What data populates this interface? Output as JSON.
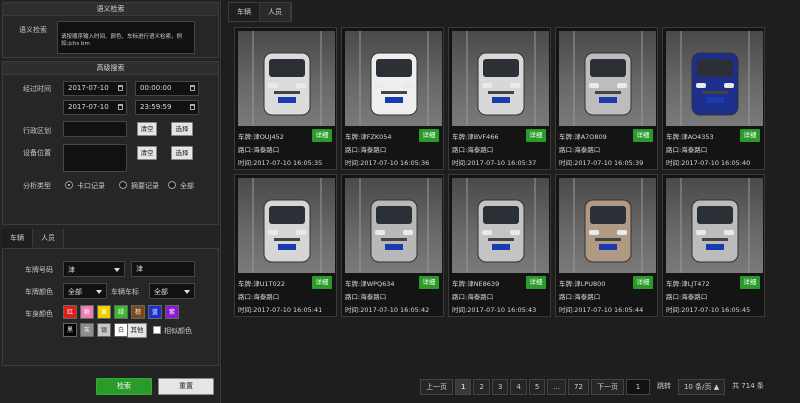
{
  "semantic": {
    "title": "语义检索",
    "label": "语义检索",
    "placeholder": "请按顺序输入时间、颜色、车标进行语义检索，例如:jchs bm"
  },
  "advanced": {
    "title": "高级搜索",
    "pass_time_label": "经过时间",
    "start_date": "2017-07-10",
    "start_time": "00:00:00",
    "end_date": "2017-07-10",
    "end_time": "23:59:59",
    "region_label": "行政区划",
    "location_label": "设备位置",
    "clear_label": "清空",
    "select_label": "选择",
    "analysis_label": "分析类型",
    "radios": [
      "卡口记录",
      "摘要记录",
      "全部"
    ]
  },
  "filter_tabs": [
    "车辆",
    "人员"
  ],
  "plate": {
    "label": "车牌号码",
    "province": "津",
    "value": "津",
    "color_label": "车牌颜色",
    "color_value": "全部",
    "brand_label": "车辆车标",
    "brand_value": "全部"
  },
  "body_color": {
    "label": "车身颜色",
    "row1": [
      {
        "name": "红",
        "color": "#e0201e"
      },
      {
        "name": "粉",
        "color": "#f07ab4"
      },
      {
        "name": "黄",
        "color": "#f0d000"
      },
      {
        "name": "绿",
        "color": "#3cb82c"
      },
      {
        "name": "棕",
        "color": "#7a4a1e"
      },
      {
        "name": "蓝",
        "color": "#1c2fd0"
      },
      {
        "name": "紫",
        "color": "#8a1ad0"
      }
    ],
    "row2": [
      {
        "name": "黑",
        "color": "#000000"
      },
      {
        "name": "灰",
        "color": "#8c8c8c"
      },
      {
        "name": "银",
        "color": "#c8c8c8"
      },
      {
        "name": "白",
        "color": "#ffffff"
      }
    ],
    "other_label": "其他",
    "similar_label": "相似颜色"
  },
  "actions": {
    "search_label": "检索",
    "reset_label": "重置"
  },
  "result_tabs": [
    "车辆",
    "人员"
  ],
  "results": [
    {
      "plate": "车牌:津OUJ452",
      "place": "路口:海泰路口",
      "time": "时间:2017-07-10 16:05:35",
      "car_color": "#dcdcdc"
    },
    {
      "plate": "车牌:津FZK054",
      "place": "路口:海泰路口",
      "time": "时间:2017-07-10 16:05:36",
      "car_color": "#eeeeee"
    },
    {
      "plate": "车牌:津BVF466",
      "place": "路口:海泰路口",
      "time": "时间:2017-07-10 16:05:37",
      "car_color": "#d8d8d8"
    },
    {
      "plate": "车牌:津A7O809",
      "place": "路口:海泰路口",
      "time": "时间:2017-07-10 16:05:39",
      "car_color": "#bdbdbd"
    },
    {
      "plate": "车牌:津AO4353",
      "place": "路口:海泰路口",
      "time": "时间:2017-07-10 16:05:40",
      "car_color": "#1e2e8c"
    },
    {
      "plate": "车牌:津U1T022",
      "place": "路口:海泰路口",
      "time": "时间:2017-07-10 16:05:41",
      "car_color": "#d6d6d6"
    },
    {
      "plate": "车牌:津WPQ634",
      "place": "路口:海泰路口",
      "time": "时间:2017-07-10 16:05:42",
      "car_color": "#b8b8b8"
    },
    {
      "plate": "车牌:津NE8639",
      "place": "路口:海泰路口",
      "time": "时间:2017-07-10 16:05:43",
      "car_color": "#c4c4c4"
    },
    {
      "plate": "车牌:津LPU800",
      "place": "路口:海泰路口",
      "time": "时间:2017-07-10 16:05:44",
      "car_color": "#b09a84"
    },
    {
      "plate": "车牌:津LJT472",
      "place": "路口:海泰路口",
      "time": "时间:2017-07-10 16:05:45",
      "car_color": "#bcbcbc"
    }
  ],
  "detail_label": "详细",
  "pager": {
    "prev": "上一页",
    "pages": [
      "1",
      "2",
      "3",
      "4",
      "5",
      "...",
      "72"
    ],
    "current_page": "1",
    "next": "下一页",
    "jump_value": "1",
    "jump_label": "跳转",
    "per_page": "10 条/页",
    "total": "共 714 条"
  }
}
